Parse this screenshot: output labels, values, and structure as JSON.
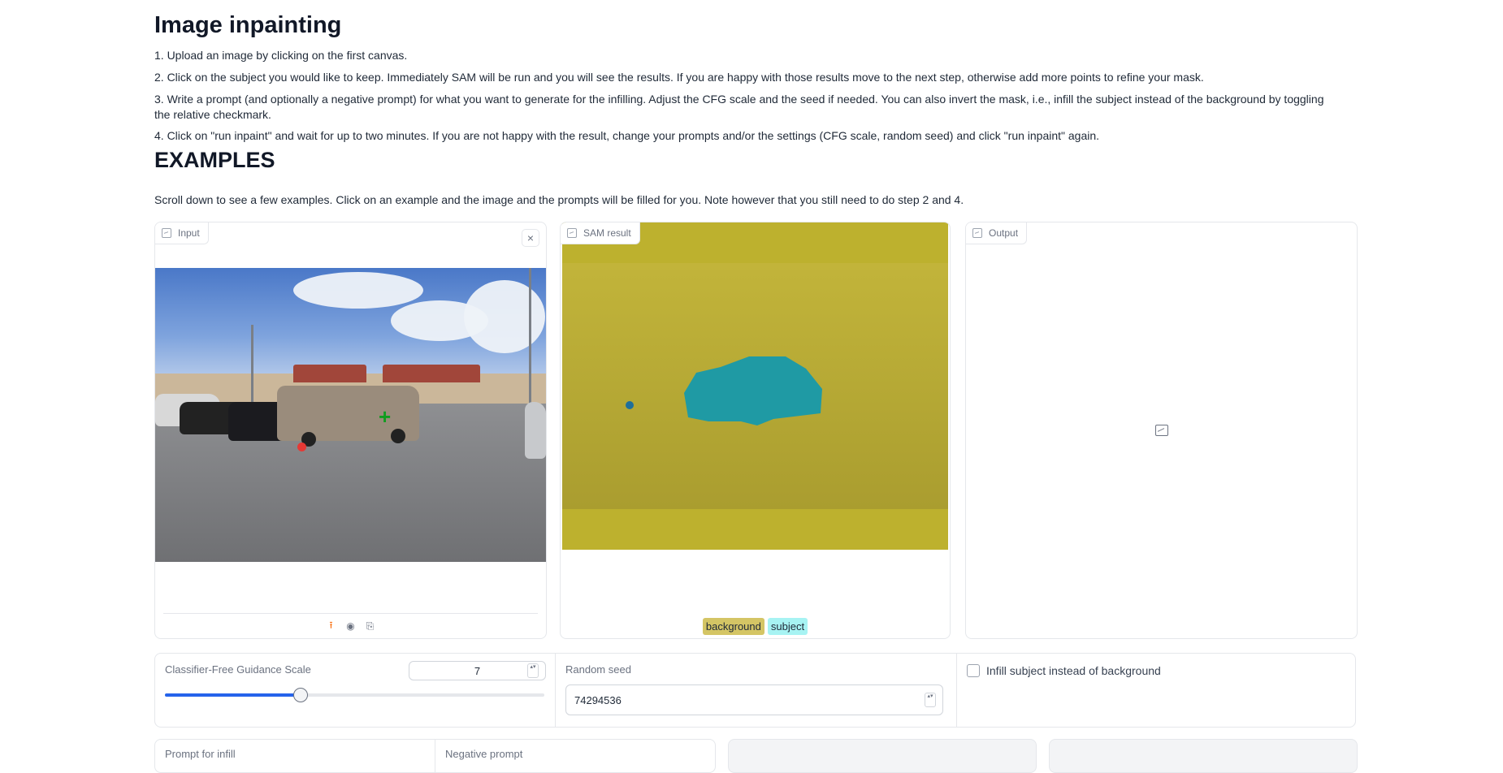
{
  "title": "Image inpainting",
  "steps": [
    "1. Upload an image by clicking on the first canvas.",
    "2. Click on the subject you would like to keep. Immediately SAM will be run and you will see the results. If you are happy with those results move to the next step, otherwise add more points to refine your mask.",
    "3. Write a prompt (and optionally a negative prompt) for what you want to generate for the infilling. Adjust the CFG scale and the seed if needed. You can also invert the mask, i.e., infill the subject instead of the background by toggling the relative checkmark.",
    "4. Click on \"run inpaint\" and wait for up to two minutes. If you are not happy with the result, change your prompts and/or the settings (CFG scale, random seed) and click \"run inpaint\" again."
  ],
  "examples_heading": "EXAMPLES",
  "examples_text": "Scroll down to see a few examples. Click on an example and the image and the prompts will be filled for you. Note however that you still need to do step 2 and 4.",
  "panels": {
    "input": {
      "label": "Input",
      "close_glyph": "×"
    },
    "sam": {
      "label": "SAM result",
      "legend": [
        "background",
        "subject"
      ]
    },
    "output": {
      "label": "Output"
    }
  },
  "toolbar_glyphs": {
    "upload": "⭱",
    "webcam": "◉",
    "clipboard": "⎘"
  },
  "settings": {
    "cfg_label": "Classifier-Free Guidance Scale",
    "cfg_value": "7",
    "cfg_fraction": 0.356,
    "seed_label": "Random seed",
    "seed_value": "74294536",
    "invert_label": "Infill subject instead of background",
    "invert_checked": false,
    "spin_glyph": "▴▾"
  },
  "bottom": {
    "prompt_label": "Prompt for infill",
    "negative_label": "Negative prompt"
  },
  "colors": {
    "accent": "#2563eb",
    "mask_background": "#bdb12e",
    "mask_subject": "#1f9aa4",
    "upload_icon": "#f97316"
  }
}
